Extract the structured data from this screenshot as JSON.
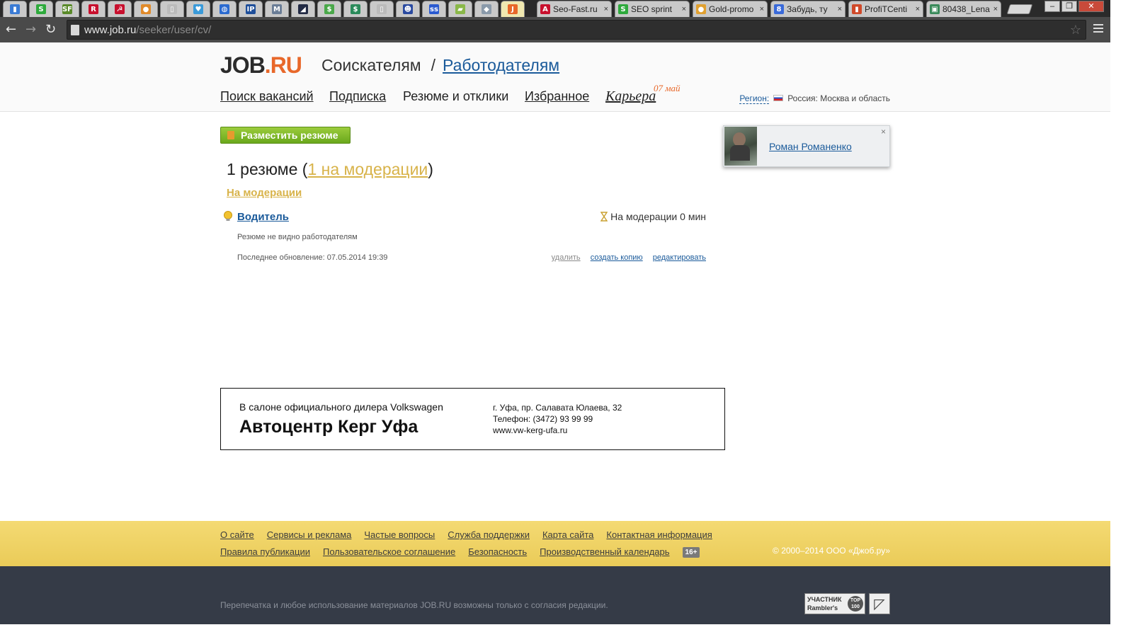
{
  "browser": {
    "pinned_tabs": [
      {
        "icon": "bars-chart-icon",
        "glyph": "▮",
        "color": "#3a7bd5"
      },
      {
        "icon": "dollar-s-icon",
        "glyph": "S",
        "color": "#2eaa3c"
      },
      {
        "icon": "sf-icon",
        "glyph": "SF",
        "color": "#5a8a2a"
      },
      {
        "icon": "r-icon",
        "glyph": "R",
        "color": "#c8102e"
      },
      {
        "icon": "soviet-star-icon",
        "glyph": "☭",
        "color": "#c8102e"
      },
      {
        "icon": "orange-circle-icon",
        "glyph": "●",
        "color": "#e08a2a"
      },
      {
        "icon": "page-icon",
        "glyph": "▯",
        "color": "#bbbbbb"
      },
      {
        "icon": "heart-icon",
        "glyph": "♥",
        "color": "#3a9ad9"
      },
      {
        "icon": "globe-icon",
        "glyph": "◍",
        "color": "#2a6ad0"
      },
      {
        "icon": "ip-icon",
        "glyph": "IP",
        "color": "#1f4f9a"
      },
      {
        "icon": "m-icon",
        "glyph": "M",
        "color": "#6a7d96"
      },
      {
        "icon": "dark-chart-icon",
        "glyph": "◢",
        "color": "#222a44"
      },
      {
        "icon": "coin-icon",
        "glyph": "$",
        "color": "#4aa84a"
      },
      {
        "icon": "dollar-box-icon",
        "glyph": "$",
        "color": "#2a8a5a"
      },
      {
        "icon": "page-icon",
        "glyph": "▯",
        "color": "#bbbbbb"
      },
      {
        "icon": "ghost-icon",
        "glyph": "☻",
        "color": "#2a4aa0"
      },
      {
        "icon": "ss-icon",
        "glyph": "ss",
        "color": "#2a5ad0"
      },
      {
        "icon": "folder-icon",
        "glyph": "▰",
        "color": "#8ab84a"
      },
      {
        "icon": "diamond-icon",
        "glyph": "◆",
        "color": "#8a9aaa"
      },
      {
        "icon": "job-j-icon",
        "glyph": "J",
        "color": "#e8682a"
      }
    ],
    "tabs": [
      {
        "icon": "a-icon",
        "glyph": "A",
        "color": "#c8102e",
        "title": "Seo-Fast.ru"
      },
      {
        "icon": "dollar-s-icon",
        "glyph": "S",
        "color": "#2eaa3c",
        "title": "SEO sprint"
      },
      {
        "icon": "orange-circle-icon",
        "glyph": "●",
        "color": "#e0a030",
        "title": "Gold-promo"
      },
      {
        "icon": "g-icon",
        "glyph": "8",
        "color": "#3a6ad9",
        "title": "Забудь, ту"
      },
      {
        "icon": "bars-chart-icon",
        "glyph": "▮",
        "color": "#d04a2a",
        "title": "ProfiTCenti"
      },
      {
        "icon": "image-icon",
        "glyph": "▣",
        "color": "#3a8a5a",
        "title": "80438_Lena"
      }
    ],
    "url_host": "www.job.ru",
    "url_path": "/seeker/user/cv/"
  },
  "header": {
    "logo_job": "JOB",
    "logo_dot": ".",
    "logo_ru": "RU",
    "seekers": "Соискателям",
    "separator": "/",
    "employers": "Работодателям",
    "menu": {
      "search": "Поиск вакансий",
      "subscription": "Подписка",
      "resumes": "Резюме и отклики",
      "favorites": "Избранное",
      "career": "Карьера",
      "career_date": "07 май"
    },
    "region_label": "Регион:",
    "region_value": "Россия: Москва и область"
  },
  "main": {
    "post_button": "Разместить резюме",
    "count_prefix": "1 резюме (",
    "count_link": "1 на модерации",
    "count_suffix": ")",
    "section_title": "На модерации",
    "cv": {
      "title": "Водитель",
      "status": "На модерации 0 мин",
      "note": "Резюме не видно работодателям",
      "updated": "Последнее обновление: 07.05.2014 19:39",
      "delete": "удалить",
      "copy": "создать копию",
      "edit": "редактировать"
    }
  },
  "user": {
    "name": "Роман Романенко",
    "close": "×"
  },
  "ad": {
    "line1": "В салоне официального дилера Volkswagen",
    "brand": "Автоцентр Керг Уфа",
    "address": "г. Уфа, пр. Салавата Юлаева, 32",
    "phone": "Телефон: (3472) 93 99 99",
    "site": "www.vw-kerg-ufa.ru"
  },
  "footer": {
    "row1": [
      "О сайте",
      "Сервисы и реклама",
      "Частые вопросы",
      "Служба поддержки",
      "Карта сайта",
      "Контактная информация"
    ],
    "row2": [
      "Правила публикации",
      "Пользовательское соглашение",
      "Безопасность",
      "Производственный календарь"
    ],
    "age": "16+",
    "copyright": "© 2000–2014 ООО «Джоб.ру»",
    "reprint": "Перепечатка и любое использование материалов JOB.RU возможны только с согласия редакции.",
    "rambler_line1": "УЧАСТНИК",
    "rambler_line2": "Rambler's",
    "rambler_badge": "TOP 100"
  }
}
